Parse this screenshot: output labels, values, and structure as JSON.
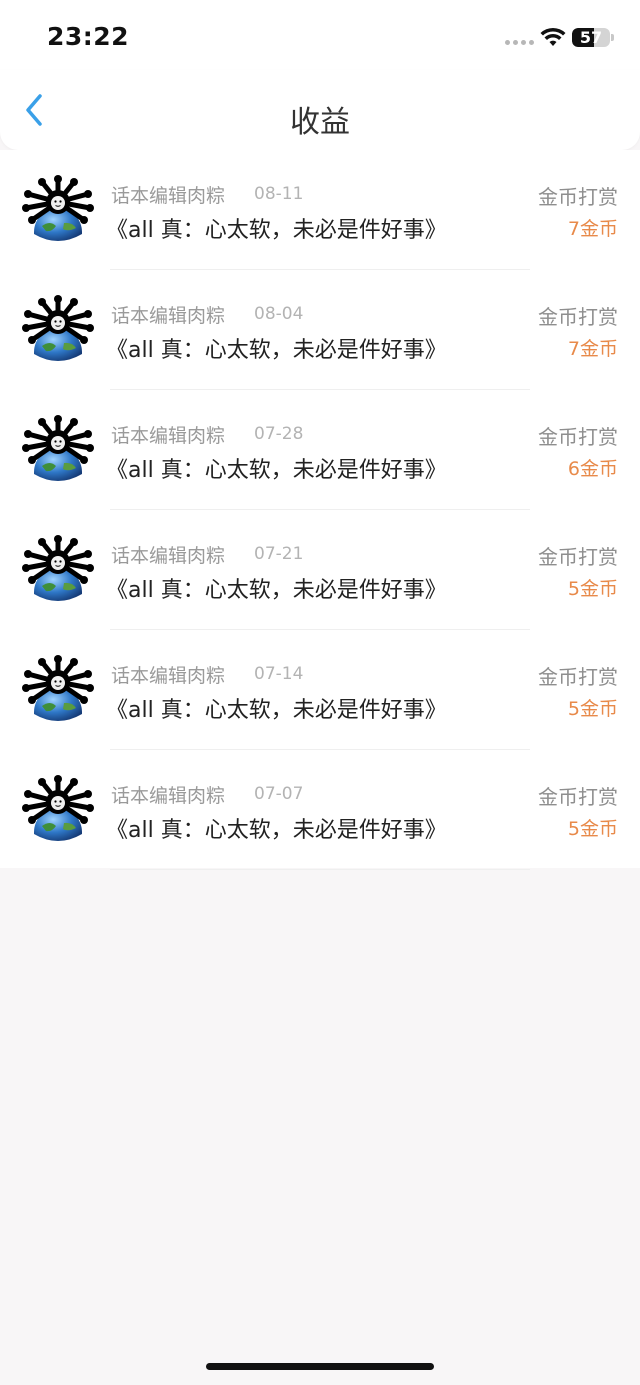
{
  "status": {
    "time": "23:22",
    "battery": "57",
    "battery_level": 0.57
  },
  "header": {
    "title": "收益"
  },
  "colors": {
    "accent": "#3aa0e8",
    "amount": "#e88a4a",
    "background": "#f8f6f7"
  },
  "rewards": [
    {
      "author": "话本编辑肉粽",
      "date": "08-11",
      "book": "《all 真：心太软，未必是件好事》",
      "type": "金币打赏",
      "amount": "7金币"
    },
    {
      "author": "话本编辑肉粽",
      "date": "08-04",
      "book": "《all 真：心太软，未必是件好事》",
      "type": "金币打赏",
      "amount": "7金币"
    },
    {
      "author": "话本编辑肉粽",
      "date": "07-28",
      "book": "《all 真：心太软，未必是件好事》",
      "type": "金币打赏",
      "amount": "6金币"
    },
    {
      "author": "话本编辑肉粽",
      "date": "07-21",
      "book": "《all 真：心太软，未必是件好事》",
      "type": "金币打赏",
      "amount": "5金币"
    },
    {
      "author": "话本编辑肉粽",
      "date": "07-14",
      "book": "《all 真：心太软，未必是件好事》",
      "type": "金币打赏",
      "amount": "5金币"
    },
    {
      "author": "话本编辑肉粽",
      "date": "07-07",
      "book": "《all 真：心太软，未必是件好事》",
      "type": "金币打赏",
      "amount": "5金币"
    }
  ]
}
